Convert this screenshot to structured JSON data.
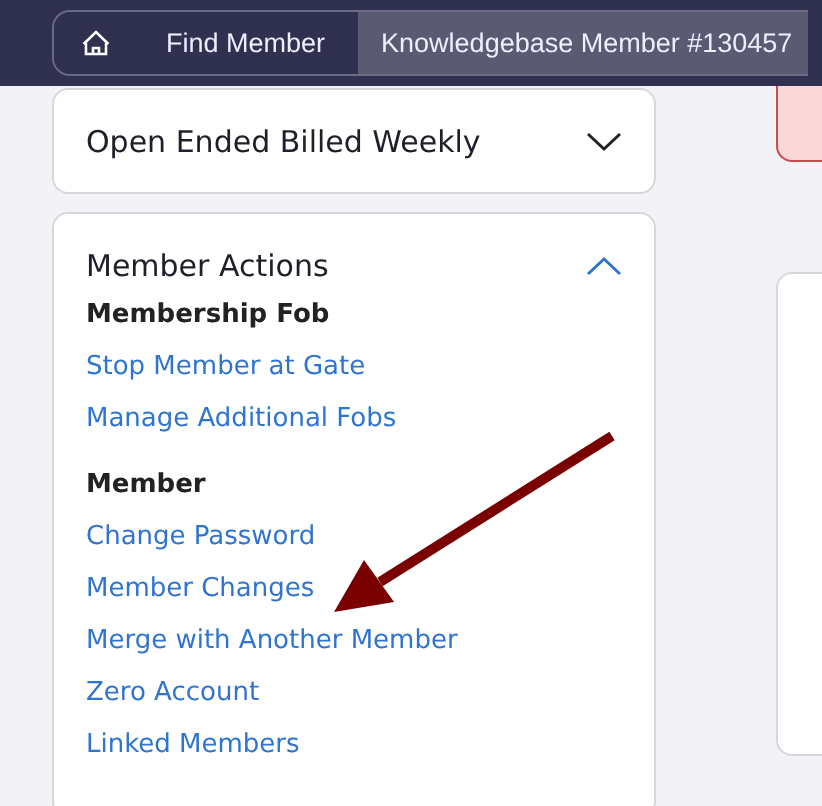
{
  "breadcrumb": [
    {
      "kind": "home"
    },
    {
      "kind": "link",
      "label": "Find Member"
    },
    {
      "kind": "current",
      "label": "Knowledgebase Member #130457"
    }
  ],
  "panels": [
    {
      "title": "Open Ended Billed Weekly",
      "expanded": false
    },
    {
      "title": "Member Actions",
      "expanded": true,
      "sections": [
        {
          "heading": "Membership Fob",
          "links": [
            "Stop Member at Gate",
            "Manage Additional Fobs"
          ]
        },
        {
          "heading": "Member",
          "links": [
            "Change Password",
            "Member Changes",
            "Merge with Another Member",
            "Zero Account",
            "Linked Members"
          ]
        }
      ]
    }
  ]
}
